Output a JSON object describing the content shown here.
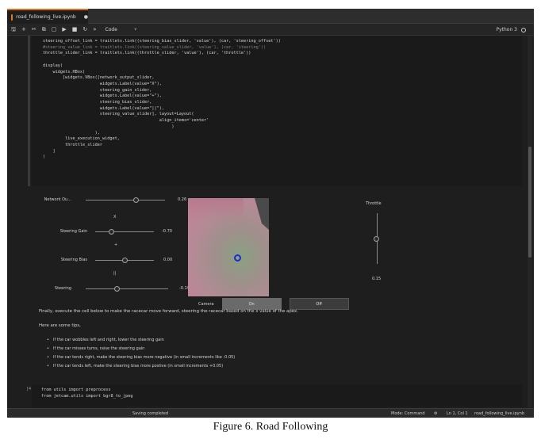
{
  "tab": {
    "title": "road_following_live.ipynb",
    "close": "●"
  },
  "toolbar": {
    "buttons": [
      {
        "name": "save-icon",
        "glyph": "🖫"
      },
      {
        "name": "add-cell-icon",
        "glyph": "+"
      },
      {
        "name": "cut-icon",
        "glyph": "✂"
      },
      {
        "name": "copy-icon",
        "glyph": "⧉"
      },
      {
        "name": "paste-icon",
        "glyph": "▢"
      },
      {
        "name": "run-icon",
        "glyph": "▶"
      },
      {
        "name": "stop-icon",
        "glyph": "■"
      },
      {
        "name": "restart-icon",
        "glyph": "↻"
      },
      {
        "name": "fast-forward-icon",
        "glyph": "»"
      }
    ],
    "cell_type": "Code",
    "caret": "∨",
    "kernel": "Python 3"
  },
  "code": {
    "lines": [
      "steering_offset_link = traitlets.link((steering_bias_slider, 'value'), (car, 'steering_offset'))",
      "#steering_value_link = traitlets.link((steering_value_slider, 'value'), (car, 'steering'))",
      "throttle_slider_link = traitlets.link((throttle_slider, 'value'), (car, 'throttle'))",
      "",
      "display(",
      "    widgets.HBox(",
      "        [widgets.VBox([network_output_slider,",
      "                       widgets.Label(value=\"X\"),",
      "                       steering_gain_slider,",
      "                       widgets.Label(value=\"+\"),",
      "                       steering_bias_slider,",
      "                       widgets.Label(value=\"||\"),",
      "                       steering_value_slider], layout=Layout(",
      "                                               align_items='center'",
      "                                                    )",
      "                     ),",
      "         live_execution_widget,",
      "         throttle_slider",
      "    ]",
      ")"
    ]
  },
  "widgets": {
    "sliders": [
      {
        "label": "Network Ou...",
        "value": "0.26",
        "fraction": 0.63
      },
      {
        "label": "Steering Gain",
        "value": "-0.70",
        "fraction": 0.28
      },
      {
        "label": "Steering Bias",
        "value": "0.00",
        "fraction": 0.5
      },
      {
        "label": "Steering",
        "value": "-0.19",
        "fraction": 0.38
      }
    ],
    "op_labels": [
      "X",
      "+",
      "||"
    ],
    "camera_label": "Camera",
    "on_label": "On",
    "off_label": "Off",
    "throttle_label": "Throttle",
    "throttle_value": "0.15",
    "throttle_fraction": 0.5
  },
  "markdown": {
    "para1": "Finally, execute the cell below to make the racecar move forward, steering the racecar based on the x value of the apex.",
    "para2": "Here are some tips,",
    "tips": [
      "If the car wobbles left and right, lower the steering gain",
      "If the car misses turns, raise the steering gain",
      "If the car tends right, make the steering bias more negative (in small increments like -0.05)",
      "If the car tends left, make the steering bias more postive (in small increments +0.05)"
    ]
  },
  "cell2": {
    "prompt": "[4]:",
    "lines": [
      "from utils import preprocess",
      "from jetcam.utils import bgr8_to_jpeg"
    ]
  },
  "status": {
    "left": "Saving completed",
    "mode": "Mode: Command",
    "position": "Ln 1, Col 1",
    "file": "road_following_live.ipynb"
  },
  "caption": "Figure 6. Road Following"
}
